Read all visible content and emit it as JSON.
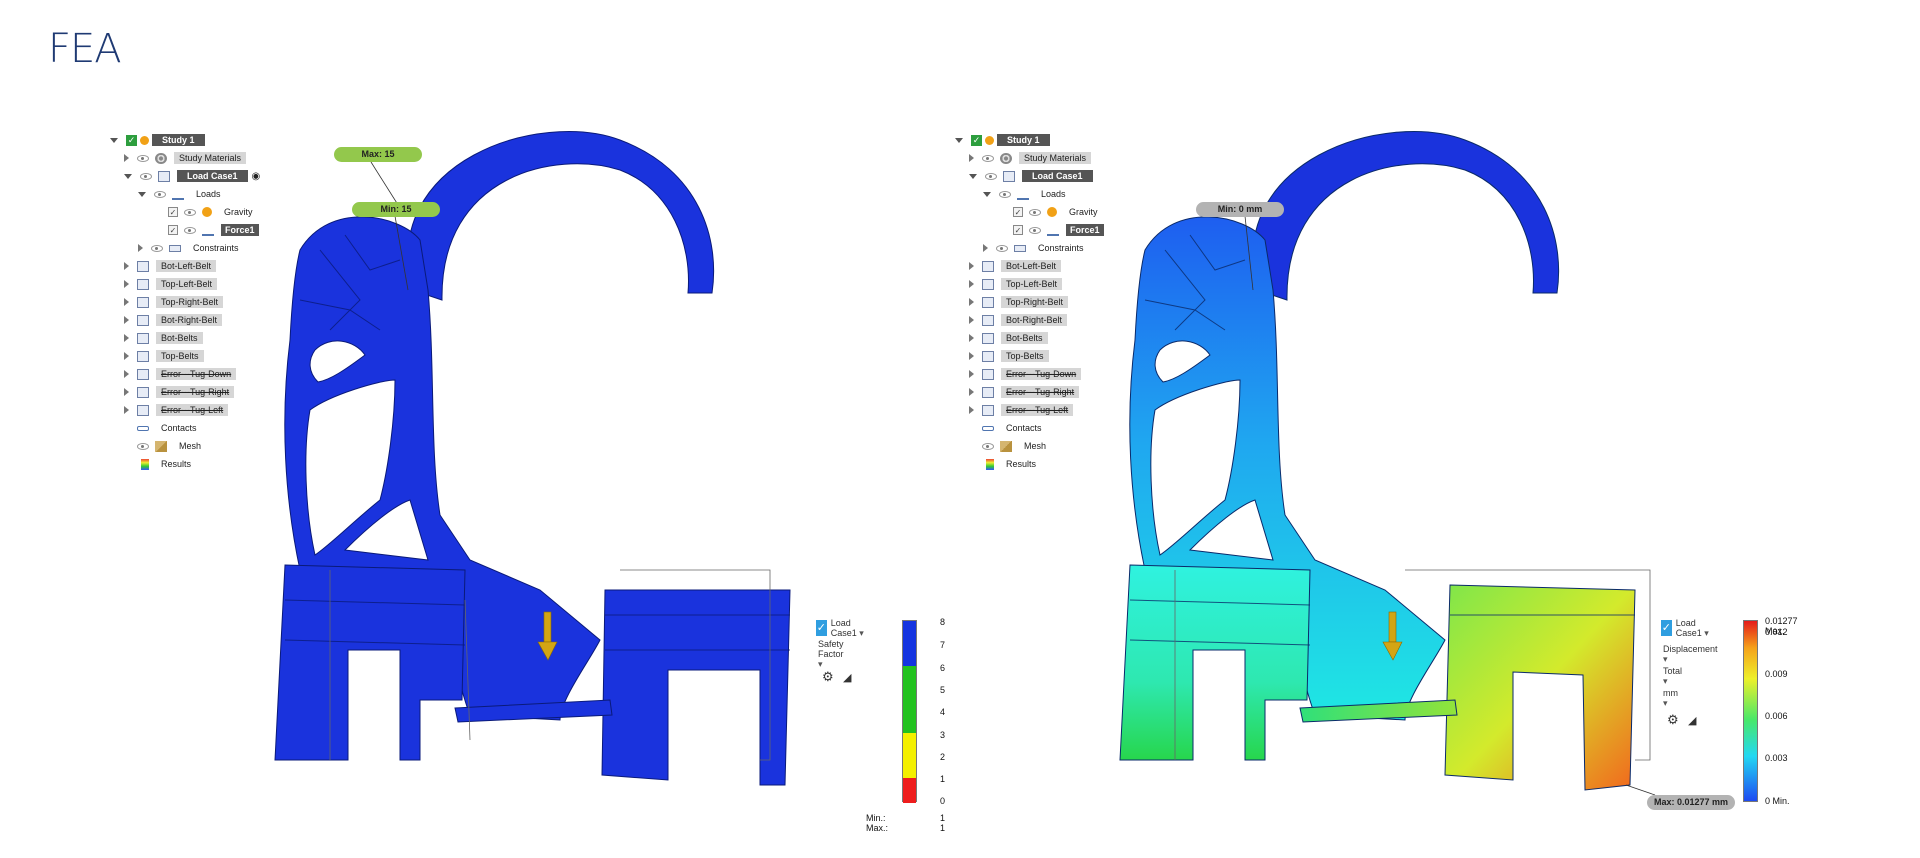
{
  "page_title": "FEA",
  "browser": {
    "study": "Study 1",
    "study_materials": "Study Materials",
    "load_case": "Load Case1",
    "loads": "Loads",
    "gravity": "Gravity",
    "force": "Force1",
    "constraints": "Constraints",
    "belts": [
      "Bot-Left-Belt",
      "Top-Left-Belt",
      "Top-Right-Belt",
      "Bot-Right-Belt",
      "Bot-Belts",
      "Top-Belts"
    ],
    "errors": [
      "Error---Tug-Down",
      "Error---Tug-Right",
      "Error---Tug-Left"
    ],
    "contacts": "Contacts",
    "mesh": "Mesh",
    "results": "Results"
  },
  "left": {
    "max_callout": "Max: 15",
    "min_callout": "Min: 15",
    "load_case_select": "Load Case1",
    "result_type": "Safety Factor",
    "legend_ticks": [
      "8",
      "7",
      "6",
      "5",
      "4",
      "3",
      "2",
      "1",
      "0"
    ],
    "min_label": "Min.:",
    "min_value": "1",
    "max_label": "Max.:",
    "max_value": "1",
    "colors": {
      "blue": "#1434e0",
      "green": "#22c21f",
      "yellow": "#f4f000",
      "red": "#ee1d1d"
    }
  },
  "right": {
    "min_callout": "Min: 0 mm",
    "max_callout": "Max: 0.01277 mm",
    "load_case_select": "Load Case1",
    "result_type": "Displacement",
    "component": "Total",
    "unit": "mm",
    "legend_ticks": [
      "0.01277 Max.",
      "0.012",
      "0.009",
      "0.006",
      "0.003",
      "0 Min."
    ]
  }
}
